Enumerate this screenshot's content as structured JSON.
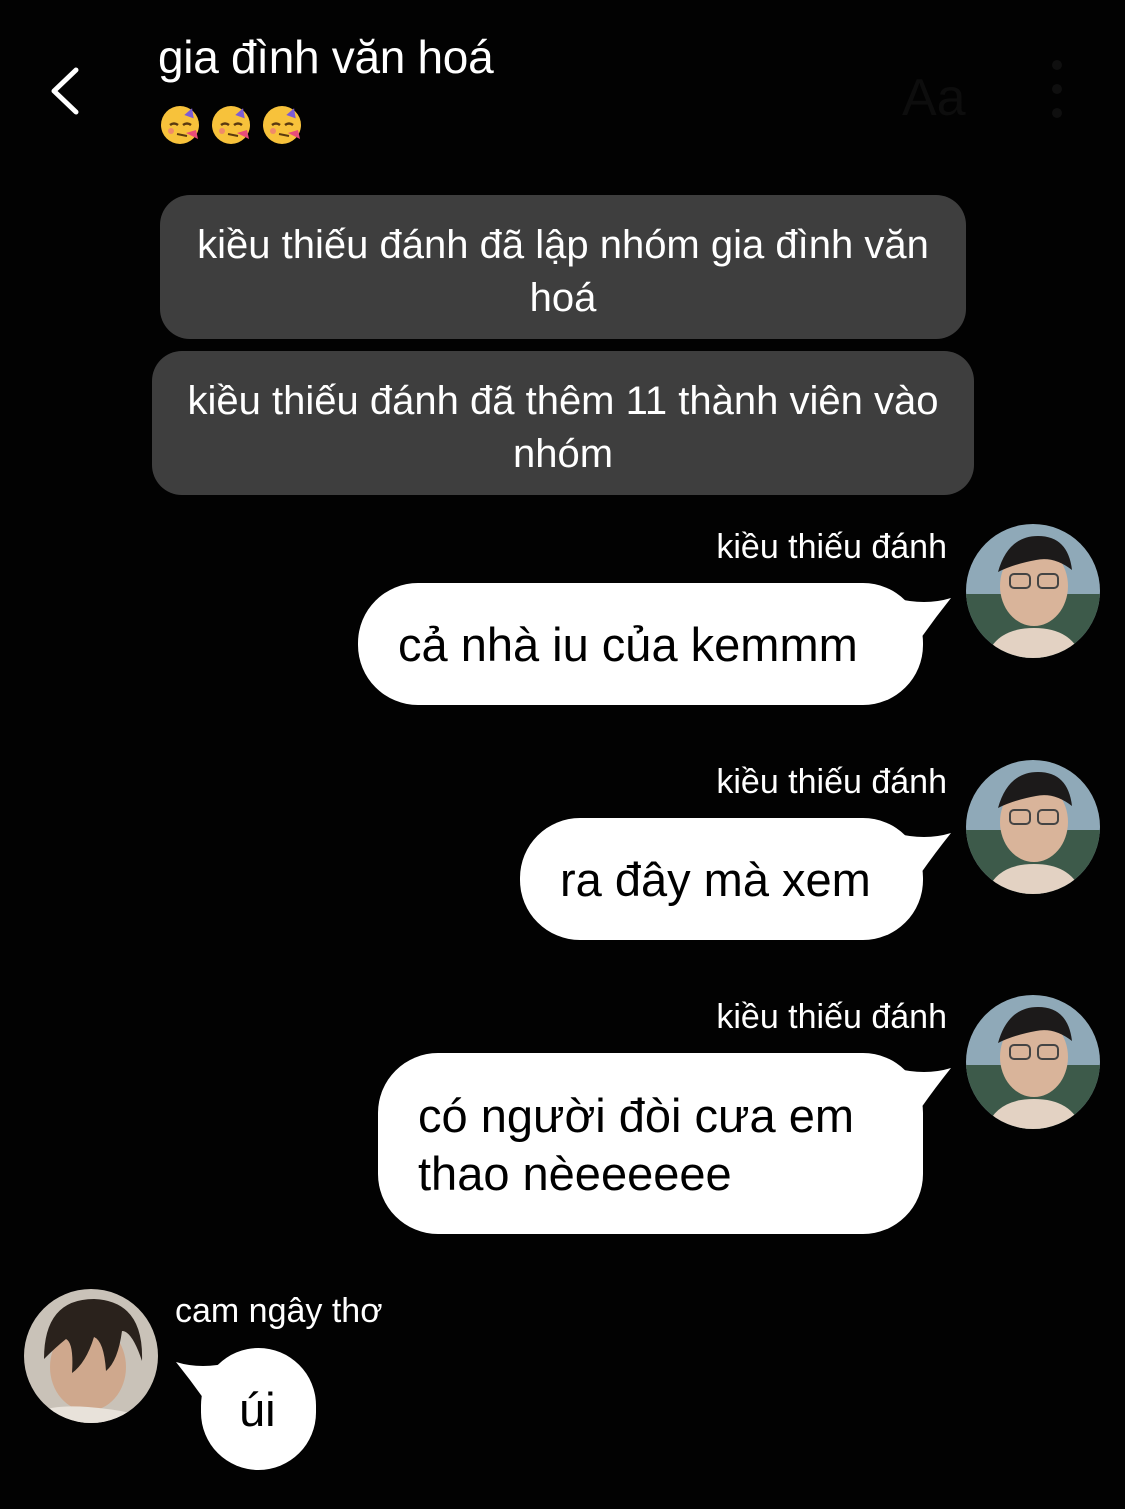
{
  "header": {
    "title": "gia đình văn hoá",
    "emojis": [
      "partying-face-icon",
      "partying-face-icon",
      "partying-face-icon"
    ],
    "faint_text": "Aa"
  },
  "system_messages": [
    "kiều thiếu đánh đã lập nhóm gia đình văn hoá",
    "kiều thiếu đánh đã thêm 11 thành viên vào nhóm"
  ],
  "messages": [
    {
      "sender": "kiều thiếu đánh",
      "text": "cả nhà iu của kemmm",
      "side": "right"
    },
    {
      "sender": "kiều thiếu đánh",
      "text": "ra đây mà xem",
      "side": "right"
    },
    {
      "sender": "kiều thiếu đánh",
      "text_lines": [
        "có người đòi cưa em",
        "thao nèeeeeee"
      ],
      "side": "right"
    },
    {
      "sender": "cam ngây thơ",
      "text": "úi",
      "side": "left"
    }
  ],
  "colors": {
    "background": "#020202",
    "system_bubble": "#3e3e3e",
    "message_bubble": "#ffffff",
    "text_light": "#ffffff",
    "text_dark": "#000000"
  }
}
